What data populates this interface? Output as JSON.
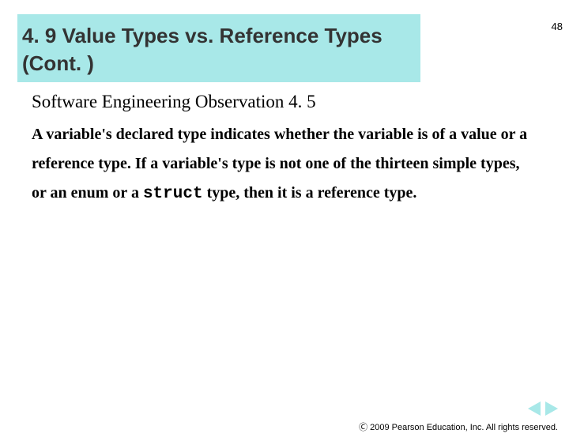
{
  "page_number": "48",
  "section_title_line1": "4. 9  Value Types vs. Reference Types",
  "section_title_line2": "(Cont. )",
  "observation_title": "Software Engineering Observation 4. 5",
  "body_before_code": "A variable's declared type indicates whether the variable is of a value or a reference type. If a variable's type is not one of the thirteen simple types, or an enum or a ",
  "code_keyword": "struct",
  "body_after_code": " type, then it is a reference type.",
  "copyright": "Ⓒ 2009 Pearson Education, Inc. All rights reserved."
}
